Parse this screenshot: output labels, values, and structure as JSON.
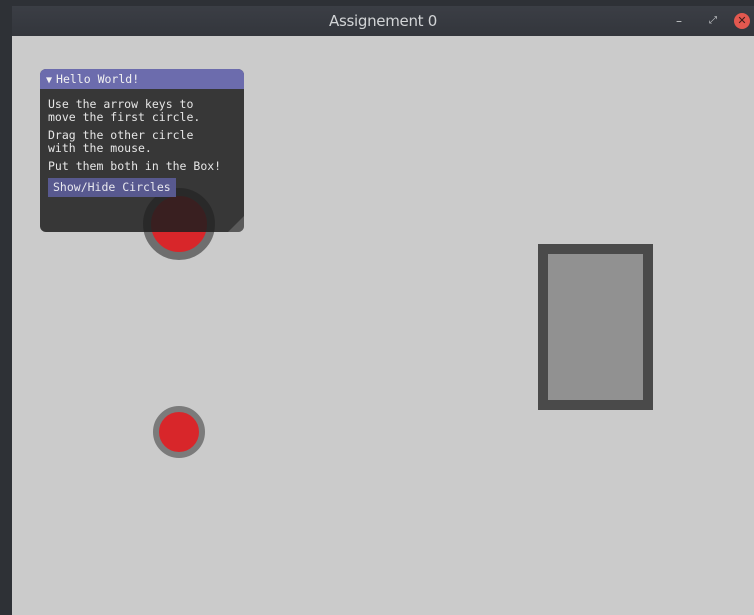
{
  "window": {
    "title": "Assignement 0",
    "controls": {
      "minimize_glyph": "–",
      "maximize_glyph": "⤢",
      "close_glyph": "✕"
    }
  },
  "panel": {
    "title": "Hello World!",
    "collapse_glyph": "▼",
    "lines": [
      "Use the arrow keys to\nmove the first circle.",
      "Drag the other circle\nwith the mouse.",
      "Put them both in the Box!"
    ],
    "button_label": "Show/Hide Circles"
  },
  "colors": {
    "background": "#cbcbcb",
    "circle_fill": "#d8262a",
    "box_border": "#4a4a4a",
    "box_fill": "#919191",
    "panel_title_bg": "#6c6cad",
    "button_bg": "#58598f",
    "titlebar": "#383b41",
    "close_button": "#e3584f"
  },
  "icons": {
    "minimize": "minimize-icon",
    "maximize": "maximize-icon",
    "close": "close-icon",
    "collapse": "triangle-down-icon",
    "resize": "resize-grip-icon"
  }
}
